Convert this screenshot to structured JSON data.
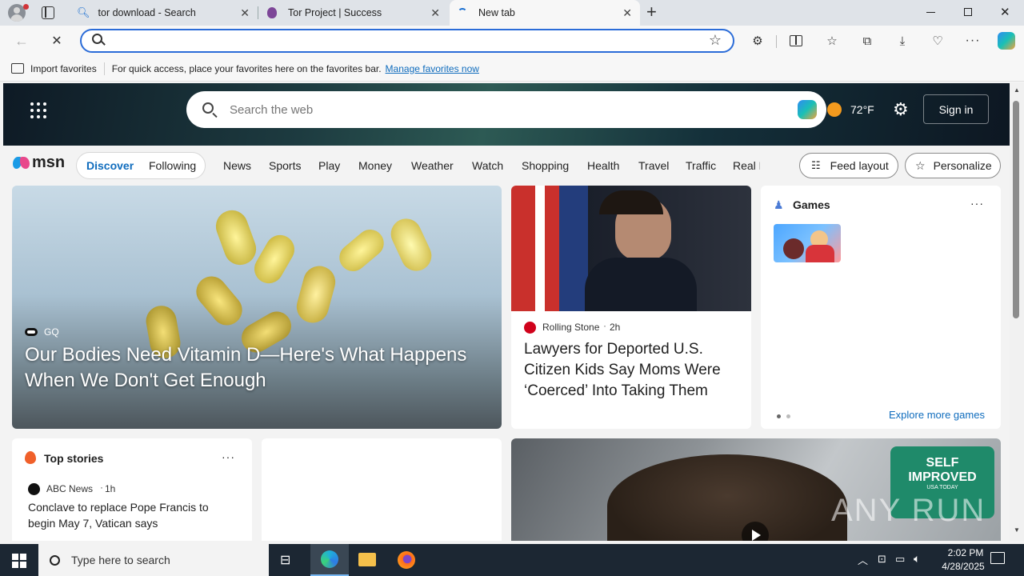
{
  "tabs": [
    {
      "label": "tor download - Search"
    },
    {
      "label": "Tor Project | Success"
    },
    {
      "label": "New tab"
    }
  ],
  "address": {
    "value": "",
    "placeholder": ""
  },
  "favorites_bar": {
    "import_label": "Import favorites",
    "message": "For quick access, place your favorites here on the favorites bar.",
    "manage_link": "Manage favorites now"
  },
  "msn": {
    "search_placeholder": "Search the web",
    "temperature": "72°F",
    "sign_in": "Sign in",
    "logo": "msn",
    "feed_tabs": [
      "Discover",
      "Following"
    ],
    "nav_items": [
      "News",
      "Sports",
      "Play",
      "Money",
      "Weather",
      "Watch",
      "Shopping",
      "Health",
      "Travel",
      "Traffic",
      "Real E"
    ],
    "feed_layout": "Feed layout",
    "personalize": "Personalize"
  },
  "hero_card": {
    "source": "GQ",
    "title": "Our Bodies Need Vitamin D—Here's What Happens When We Don't Get Enough"
  },
  "news_card": {
    "source": "Rolling Stone",
    "time": "2h",
    "title": "Lawyers for Deported U.S. Citizen Kids Say Moms Were ‘Coerced’ Into Taking Them"
  },
  "games_card": {
    "title": "Games",
    "more": "Explore more games"
  },
  "top_stories": {
    "title": "Top stories",
    "source": "ABC News",
    "time": "1h",
    "headline": "Conclave to replace Pope Francis to begin May 7, Vatican says"
  },
  "video_card": {
    "badge_line1": "SELF",
    "badge_line2": "IMPROVED",
    "badge_line3": "USA TODAY",
    "watermark": "ANY RUN"
  },
  "taskbar": {
    "search_placeholder": "Type here to search",
    "time": "2:02 PM",
    "date": "4/28/2025"
  },
  "colors": {
    "accent": "#0f6cbd",
    "address_border": "#2b6cd8",
    "taskbar": "#1c2733"
  }
}
